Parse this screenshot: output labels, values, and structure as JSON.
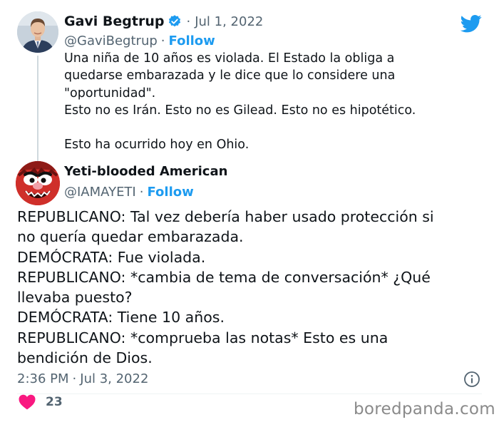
{
  "parent_tweet": {
    "author_name": "Gavi Begtrup",
    "date": "Jul 1, 2022",
    "handle": "@GaviBegtrup",
    "follow_label": "Follow",
    "lines": [
      "Una niña de 10 años es violada. El Estado la obliga a",
      "quedarse embarazada y le dice que lo considere una",
      "\"oportunidad\".",
      "Esto no es Irán. Esto no es Gilead. Esto no es hipotético.",
      "",
      "Esto ha ocurrido hoy en Ohio."
    ]
  },
  "reply_tweet": {
    "author_name": "Yeti-blooded American",
    "handle": "@IAMAYETI",
    "follow_label": "Follow",
    "lines": [
      "REPUBLICANO: Tal vez debería haber usado protección si",
      "no quería quedar embarazada.",
      "DEMÓCRATA: Fue violada.",
      "REPUBLICANO: *cambia de tema de conversación* ¿Qué",
      "llevaba puesto?",
      "DEMÓCRATA: Tiene 10 años.",
      "REPUBLICANO: *comprueba las notas* Esto es una",
      "bendición de Dios."
    ],
    "time": "2:36 PM",
    "date": "Jul 3, 2022",
    "like_count": "23"
  },
  "separator_dot": "·",
  "watermark": "boredpanda.com",
  "icons": {
    "platform": "twitter-bird-icon",
    "verified": "verified-badge-icon",
    "info": "info-icon",
    "like": "heart-icon"
  },
  "colors": {
    "accent": "#1d9bf0",
    "text": "#0f1419",
    "muted": "#536471",
    "like": "#f91880"
  }
}
